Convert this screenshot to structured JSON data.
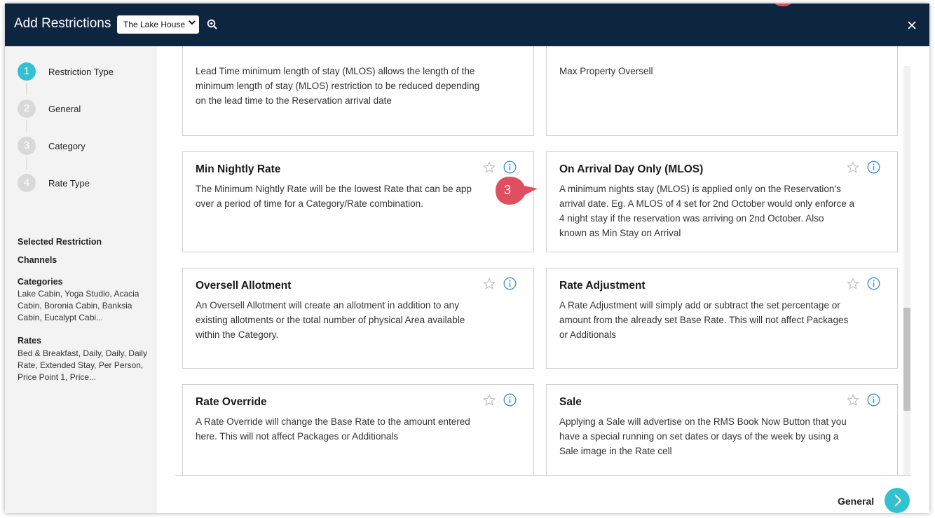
{
  "header": {
    "title": "Add Restrictions",
    "property_select": "The Lake House"
  },
  "steps": [
    {
      "num": "1",
      "label": "Restriction Type"
    },
    {
      "num": "2",
      "label": "General"
    },
    {
      "num": "3",
      "label": "Category"
    },
    {
      "num": "4",
      "label": "Rate Type"
    }
  ],
  "summary": {
    "selected_restriction": "Selected Restriction",
    "channels": "Channels",
    "categories_heading": "Categories",
    "categories_value": "Lake Cabin, Yoga Studio, Acacia Cabin, Boronia Cabin, Banksia Cabin, Eucalypt Cabi...",
    "rates_heading": "Rates",
    "rates_value": "Bed & Breakfast, Daily, Daily, Daily Rate, Extended Stay, Per Person, Price Point 1, Price..."
  },
  "cards": [
    {
      "title": "",
      "desc": "Lead Time minimum length of stay (MLOS) allows the length of the\nminimum length of stay (MLOS) restriction to be reduced depending\non the lead time to the Reservation arrival date"
    },
    {
      "title": "",
      "desc": "Max Property Oversell"
    },
    {
      "title": "Min Nightly Rate",
      "desc": "The Minimum Nightly Rate will be the lowest Rate that can be app\nover a period of time for a Category/Rate combination."
    },
    {
      "title": "On Arrival Day Only (MLOS)",
      "desc": "A minimum nights stay (MLOS) is applied only on the Reservation's\narrival date. Eg. A MLOS of 4 set for 2nd October would only enforce a\n4 night stay if the reservation was arriving on 2nd October. Also\nknown as Min Stay on Arrival"
    },
    {
      "title": "Oversell Allotment",
      "desc": "An Oversell Allotment will create an allotment in addition to any\nexisting allotments or the total number of physical Area available\nwithin the Category."
    },
    {
      "title": "Rate Adjustment",
      "desc": "A Rate Adjustment will simply add or subtract the set percentage or\namount from the already set Base Rate. This will not affect Packages\nor Additionals"
    },
    {
      "title": "Rate Override",
      "desc": "A Rate Override will change the Base Rate to the amount entered\nhere. This will not affect Packages or Additionals"
    },
    {
      "title": "Sale",
      "desc": "Applying a Sale will advertise on the RMS Book Now Button that you\nhave a special running on set dates or days of the week by using a\nSale image in the Rate cell"
    }
  ],
  "callout_badge": "3",
  "footer": {
    "next_label": "General"
  },
  "colors": {
    "header_bg": "#0e2540",
    "accent": "#32c1d1",
    "badge": "#e04f60"
  }
}
